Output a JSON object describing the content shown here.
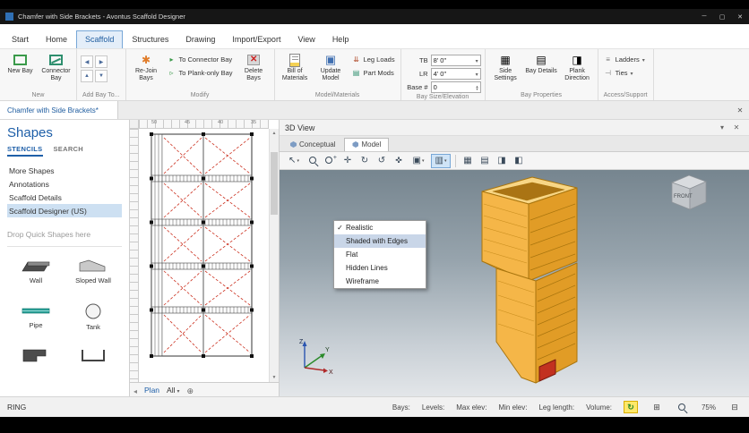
{
  "window": {
    "title": "Chamfer with Side Brackets - Avontus Scaffold Designer"
  },
  "menu_tabs": [
    "Start",
    "Home",
    "Scaffold",
    "Structures",
    "Drawing",
    "Import/Export",
    "View",
    "Help"
  ],
  "ribbon": {
    "new": {
      "label": "New",
      "new_bay": "New Bay",
      "connector_bay": "Connector Bay"
    },
    "add_bay": {
      "label": "Add Bay To..."
    },
    "modify": {
      "label": "Modify",
      "rejoin": "Re-Join Bays",
      "to_connector": "To Connector Bay",
      "to_plank": "To Plank-only Bay",
      "delete": "Delete Bays"
    },
    "model": {
      "label": "Model/Materials",
      "bom": "Bill of Materials",
      "update": "Update Model",
      "leg_loads": "Leg Loads",
      "part_mods": "Part Mods"
    },
    "size": {
      "label": "Bay Size/Elevation",
      "tb": "TB",
      "tb_value": "8' 0\"",
      "lr": "LR",
      "lr_value": "4' 0\"",
      "base": "Base #",
      "base_value": "0"
    },
    "props": {
      "label": "Bay Properties",
      "side": "Side Settings",
      "details": "Bay Details",
      "plank": "Plank Direction"
    },
    "access": {
      "label": "Access/Support",
      "ladders": "Ladders",
      "ties": "Ties"
    }
  },
  "doc_tab": "Chamfer with Side Brackets*",
  "shapes": {
    "title": "Shapes",
    "tab_stencils": "STENCILS",
    "tab_search": "SEARCH",
    "items": [
      "More Shapes",
      "Annotations",
      "Scaffold Details",
      "Scaffold Designer (US)"
    ],
    "drop_hint": "Drop Quick Shapes here",
    "labels": [
      "Wall",
      "Sloped Wall",
      "Pipe",
      "Tank"
    ]
  },
  "plan": {
    "ruler": [
      "50",
      "45",
      "40",
      "35"
    ],
    "tab": "Plan",
    "filter": "All"
  },
  "view3d": {
    "title": "3D View",
    "tab_conceptual": "Conceptual",
    "tab_model": "Model",
    "menu_items": [
      "Realistic",
      "Shaded with Edges",
      "Flat",
      "Hidden Lines",
      "Wireframe"
    ],
    "cube": "FRONT",
    "axis_x": "X",
    "axis_y": "Y",
    "axis_z": "Z"
  },
  "status": {
    "mode": "RING",
    "bays": "Bays:",
    "levels": "Levels:",
    "max": "Max elev:",
    "min": "Min elev:",
    "leg": "Leg length:",
    "volume": "Volume:",
    "zoom": "75%"
  },
  "colors": {
    "accent": "#1e5fa8",
    "scaffold": "#f0a832",
    "highlight": "#ffe86a"
  }
}
